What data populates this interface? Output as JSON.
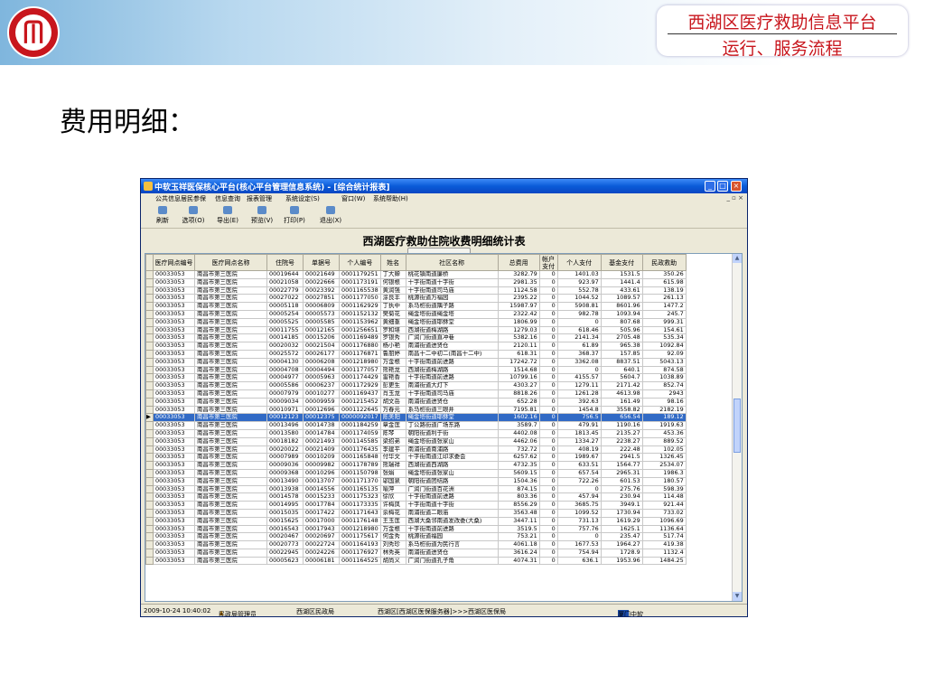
{
  "slide": {
    "brand_line1": "西湖区医疗救助信息平台",
    "brand_line2": "运行、服务流程",
    "heading": "费用明细："
  },
  "app": {
    "window_title": "中软玉祥医保核心平台(核心平台管理信息系统) - [综合统计报表]",
    "menu": [
      "公共信息",
      "居民参保",
      "信息查询",
      "报表管理",
      "系统设定(S)",
      "窗口(W)",
      "系统帮助(H)"
    ],
    "toolbar": [
      "刷新",
      "选项(O)",
      "导出(E)",
      "预览(V)",
      "打印(P)",
      "退出(X)"
    ],
    "report_title": "西湖医疗救助住院收费明细统计表",
    "columns": [
      "医疗网点编号",
      "医疗网点名称",
      "住院号",
      "单据号",
      "个人编号",
      "姓名",
      "社区名称",
      "总费用",
      "帐户支付",
      "个人支付",
      "基金支付",
      "民政救助"
    ],
    "rows": [
      [
        "00033053",
        "南昌市第三医院",
        "00019644",
        "00021649",
        "0001179251",
        "丁大蝉",
        "桃花镇南道廉桥",
        "3282.79",
        "0",
        "1401.03",
        "1531.5",
        "350.26"
      ],
      [
        "00033053",
        "南昌市第三医院",
        "00021058",
        "00022666",
        "0001173191",
        "何银根",
        "十字街南道十字街",
        "2981.35",
        "0",
        "923.97",
        "1441.4",
        "615.98"
      ],
      [
        "00033053",
        "南昌市第三医院",
        "00022779",
        "00023392",
        "0001165538",
        "黄润强",
        "十字街南道司马庙",
        "1124.58",
        "0",
        "552.78",
        "433.61",
        "138.19"
      ],
      [
        "00033053",
        "南昌市第三医院",
        "00027022",
        "00027851",
        "0001177050",
        "涂良丰",
        "桃源街道万福园",
        "2395.22",
        "0",
        "1044.52",
        "1089.57",
        "261.13"
      ],
      [
        "00033053",
        "南昌市第三医院",
        "00005118",
        "00006809",
        "0001162929",
        "丁执中",
        "系马桩街道隅子路",
        "15987.97",
        "0",
        "5908.81",
        "8601.96",
        "1477.2"
      ],
      [
        "00033053",
        "南昌市第三医院",
        "00005254",
        "00005573",
        "0001152132",
        "樊菊花",
        "绳金塔街道绳金塔",
        "2322.42",
        "0",
        "982.78",
        "1093.94",
        "245.7"
      ],
      [
        "00033053",
        "南昌市第三医院",
        "00005525",
        "00005585",
        "0001153962",
        "黄细重",
        "绳金塔街道耶稣堂",
        "1806.99",
        "0",
        "0",
        "807.68",
        "999.31"
      ],
      [
        "00033053",
        "南昌市第三医院",
        "00011755",
        "00012165",
        "0001256651",
        "罗和堪",
        "西湖街道梅湖路",
        "1279.03",
        "0",
        "618.46",
        "505.96",
        "154.61"
      ],
      [
        "00033053",
        "南昌市第三医院",
        "00014185",
        "00015206",
        "0001169489",
        "罗银秀",
        "广润门街道直冲巷",
        "5382.16",
        "0",
        "2141.34",
        "2705.48",
        "535.34"
      ],
      [
        "00033053",
        "南昌市第三医院",
        "00020032",
        "00021504",
        "0001176880",
        "杨小艳",
        "南浦街道进贤仓",
        "2120.11",
        "0",
        "61.89",
        "965.38",
        "1092.84"
      ],
      [
        "00033053",
        "南昌市第三医院",
        "00025572",
        "00026177",
        "0001176871",
        "鲁朋婷",
        "南昌十二中初二(南昌十二中)",
        "618.31",
        "0",
        "368.37",
        "157.85",
        "92.09"
      ],
      [
        "00033053",
        "南昌市第三医院",
        "00004130",
        "00006208",
        "0001218980",
        "万金根",
        "十字街南道前进路",
        "17242.72",
        "0",
        "3362.08",
        "8837.51",
        "5043.13"
      ],
      [
        "00033053",
        "南昌市第三医院",
        "00004708",
        "00004494",
        "0001177057",
        "熊艳龙",
        "西湖街道梅湖路",
        "1514.68",
        "0",
        "0",
        "640.1",
        "874.58"
      ],
      [
        "00033053",
        "南昌市第三医院",
        "00004977",
        "00005963",
        "0001174429",
        "雷艳香",
        "十字街南道前进路",
        "10799.16",
        "0",
        "4155.57",
        "5604.7",
        "1038.89"
      ],
      [
        "00033053",
        "南昌市第三医院",
        "00005586",
        "00006237",
        "0001172929",
        "彭更生",
        "南浦街道大灯下",
        "4303.27",
        "0",
        "1279.11",
        "2171.42",
        "852.74"
      ],
      [
        "00033053",
        "南昌市第三医院",
        "00007979",
        "00010277",
        "0001169437",
        "肖玉龙",
        "十字街南道司马庙",
        "8818.26",
        "0",
        "1261.28",
        "4613.98",
        "2943"
      ],
      [
        "00033053",
        "南昌市第三医院",
        "00009034",
        "00009959",
        "0001215452",
        "胡文岳",
        "南浦街道进贤仓",
        "652.28",
        "0",
        "392.63",
        "161.49",
        "98.16"
      ],
      [
        "00033053",
        "南昌市第三医院",
        "00010971",
        "00012696",
        "0001122645",
        "万春元",
        "系马桩街道三眼井",
        "7195.81",
        "0",
        "1454.8",
        "3558.82",
        "2182.19"
      ],
      [
        "00033053",
        "南昌市第三医院",
        "00012123",
        "00012375",
        "0000092017",
        "陈美阳",
        "绳金塔街道耶稣堂",
        "1602.16",
        "0",
        "756.5",
        "656.54",
        "189.12"
      ],
      [
        "00033053",
        "南昌市第三医院",
        "00013496",
        "00014738",
        "0001184259",
        "章金莲",
        "丁公路街道广场东路",
        "3589.7",
        "0",
        "479.91",
        "1190.16",
        "1919.63"
      ],
      [
        "00033053",
        "南昌市第三医院",
        "00013580",
        "00014784",
        "0001174059",
        "陈琴",
        "朝阳街道利于街",
        "4402.08",
        "0",
        "1813.45",
        "2135.27",
        "453.36"
      ],
      [
        "00033053",
        "南昌市第三医院",
        "00018182",
        "00021493",
        "0001145585",
        "梁招弟",
        "绳金塔街道张家山",
        "4462.06",
        "0",
        "1334.27",
        "2238.27",
        "889.52"
      ],
      [
        "00033053",
        "南昌市第三医院",
        "00020022",
        "00021409",
        "0001176435",
        "李建平",
        "南浦街道南浦路",
        "732.72",
        "0",
        "408.19",
        "222.48",
        "102.05"
      ],
      [
        "00033053",
        "南昌市第三医院",
        "00007989",
        "00010209",
        "0001165848",
        "付华文",
        "十字街南道江印求委会",
        "6257.62",
        "0",
        "1989.67",
        "2941.5",
        "1326.45"
      ],
      [
        "00033053",
        "南昌市第三医院",
        "00009036",
        "00009982",
        "0001178789",
        "熊瑞祥",
        "西湖街道西湖路",
        "4732.35",
        "0",
        "633.51",
        "1564.77",
        "2534.07"
      ],
      [
        "00033053",
        "南昌市第三医院",
        "00009368",
        "00010296",
        "0001150798",
        "张娟",
        "绳金塔街道张家山",
        "5609.15",
        "0",
        "657.54",
        "2965.31",
        "1986.3"
      ],
      [
        "00033053",
        "南昌市第三医院",
        "00013490",
        "00013707",
        "0001171370",
        "邬国泉",
        "朝阳街道团结路",
        "1504.36",
        "0",
        "722.26",
        "601.53",
        "180.57"
      ],
      [
        "00033053",
        "南昌市第三医院",
        "00013938",
        "00014556",
        "0001165135",
        "喻萍",
        "广润门街道百花洲",
        "874.15",
        "0",
        "0",
        "275.76",
        "598.39"
      ],
      [
        "00033053",
        "南昌市第三医院",
        "00014578",
        "00015233",
        "0001175323",
        "徐欣",
        "十字街南道前进路",
        "803.36",
        "0",
        "457.94",
        "230.94",
        "114.48"
      ],
      [
        "00033053",
        "南昌市第三医院",
        "00014995",
        "00017784",
        "0001173335",
        "许梅凤",
        "十字街南道十字街",
        "8556.29",
        "0",
        "3685.75",
        "3949.1",
        "921.44"
      ],
      [
        "00033053",
        "南昌市第三医院",
        "00015035",
        "00017422",
        "0001171643",
        "余梅花",
        "南浦街道二眼庙",
        "3563.48",
        "0",
        "1099.52",
        "1730.94",
        "733.02"
      ],
      [
        "00033053",
        "南昌市第三医院",
        "00015625",
        "00017000",
        "0001176148",
        "王玉莲",
        "西湖大桑邻南道发改委(大桑)",
        "3447.11",
        "0",
        "731.13",
        "1619.29",
        "1096.69"
      ],
      [
        "00033053",
        "南昌市第三医院",
        "00016543",
        "00017943",
        "0001218980",
        "万金根",
        "十字街南道前进路",
        "3519.5",
        "0",
        "757.76",
        "1625.1",
        "1136.64"
      ],
      [
        "00033053",
        "南昌市第三医院",
        "00020467",
        "00020697",
        "0001175617",
        "何金秀",
        "桃源街道福园",
        "753.21",
        "0",
        "0",
        "235.47",
        "517.74"
      ],
      [
        "00033053",
        "南昌市第三医院",
        "00020773",
        "00022724",
        "0001164193",
        "刘秀珍",
        "系马桩街道为民行言",
        "4061.18",
        "0",
        "1677.53",
        "1964.27",
        "419.38"
      ],
      [
        "00033053",
        "南昌市第三医院",
        "00022945",
        "00024226",
        "0001176927",
        "林秀英",
        "南浦街道进贤仓",
        "3616.24",
        "0",
        "754.94",
        "1728.9",
        "1132.4"
      ],
      [
        "00033053",
        "南昌市第三医院",
        "00005623",
        "00006181",
        "0001164525",
        "胡尚义",
        "广润门街道孔子角",
        "4074.31",
        "0",
        "636.1",
        "1953.96",
        "1484.25"
      ]
    ],
    "selected_row_index": 18,
    "status": {
      "datetime": "2009-10-24 10:40:02",
      "user": "民政局管理员",
      "dept": "西湖区民政局",
      "server": "西湖区[西湖区医保服务器]>>>西湖区医保局",
      "vendor": "厦门中软"
    }
  }
}
